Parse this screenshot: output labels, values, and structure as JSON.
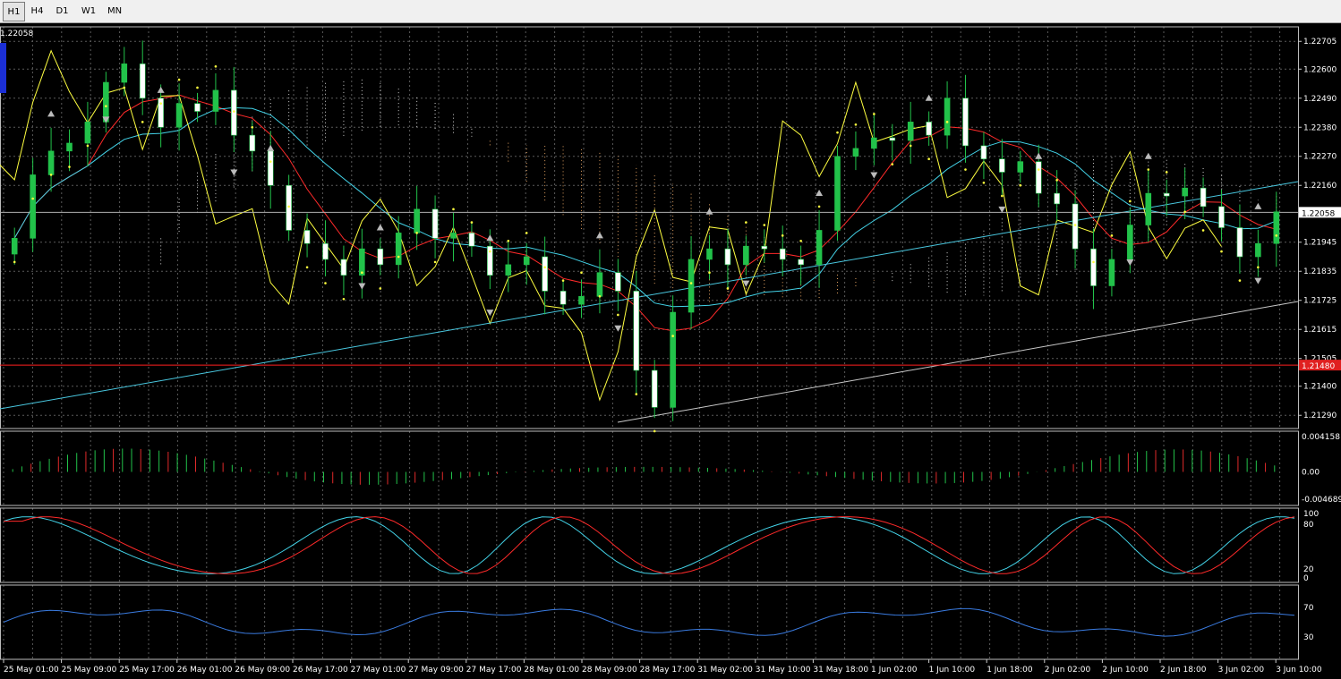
{
  "toolbar": {
    "timeframes": [
      {
        "label": "H1",
        "active": true
      },
      {
        "label": "H4",
        "active": false
      },
      {
        "label": "D1",
        "active": false
      },
      {
        "label": "W1",
        "active": false
      },
      {
        "label": "MN",
        "active": false
      }
    ]
  },
  "main_panel": {
    "top_left_price": "1.22058",
    "price_ticks": [
      "1.22705",
      "1.22600",
      "1.22490",
      "1.22380",
      "1.22270",
      "1.22160",
      "1.21945",
      "1.21835",
      "1.21725",
      "1.21615",
      "1.21505",
      "1.21400",
      "1.21290"
    ],
    "current_price": "1.22058",
    "red_level_label": "1.21480",
    "y_range": [
      1.2124,
      1.2276
    ]
  },
  "macd_panel": {
    "ticks": [
      "0.004158",
      "0.00",
      "-0.004689"
    ]
  },
  "stoch_panel": {
    "ticks": [
      "100",
      "80",
      "20",
      "0"
    ]
  },
  "rsi_panel": {
    "ticks": [
      "70",
      "30"
    ]
  },
  "time_axis": [
    "25 May 01:00",
    "25 May 09:00",
    "25 May 17:00",
    "26 May 01:00",
    "26 May 09:00",
    "26 May 17:00",
    "27 May 01:00",
    "27 May 09:00",
    "27 May 17:00",
    "28 May 01:00",
    "28 May 09:00",
    "28 May 17:00",
    "31 May 02:00",
    "31 May 10:00",
    "31 May 18:00",
    "1 Jun 02:00",
    "1 Jun 10:00",
    "1 Jun 18:00",
    "2 Jun 02:00",
    "2 Jun 10:00",
    "2 Jun 18:00",
    "3 Jun 02:00",
    "3 Jun 10:00"
  ],
  "colors": {
    "bull": "#22c24a",
    "bear": "#ffffff",
    "grid": "#5a5a5a",
    "kijun": "#ff2a2a",
    "tenkan": "#43d3e8",
    "chikou": "#ffff40",
    "trend_cyan": "#49c8e0",
    "trend_gray": "#c8c8c8",
    "level_red": "#ff2020",
    "macd_up": "#22c24a",
    "macd_down": "#e02a2a",
    "stoch_main": "#43d3e8",
    "stoch_signal": "#ff2a2a",
    "rsi": "#3a7be0"
  },
  "chart_data": {
    "type": "candlestick",
    "series_close": [
      1.2196,
      1.222,
      1.2229,
      1.2232,
      1.224,
      1.2255,
      1.2262,
      1.2249,
      1.2238,
      1.2247,
      1.2244,
      1.2252,
      1.2235,
      1.2229,
      1.2216,
      1.2199,
      1.2194,
      1.2188,
      1.2182,
      1.2192,
      1.2186,
      1.2198,
      1.2207,
      1.2196,
      1.2198,
      1.2193,
      1.2182,
      1.2186,
      1.2189,
      1.2176,
      1.2171,
      1.2174,
      1.2183,
      1.2176,
      1.2146,
      1.2132,
      1.2168,
      1.2188,
      1.2192,
      1.2186,
      1.2193,
      1.2192,
      1.2188,
      1.2186,
      1.2199,
      1.2227,
      1.223,
      1.2234,
      1.2233,
      1.224,
      1.2235,
      1.2249,
      1.2231,
      1.2226,
      1.2221,
      1.2225,
      1.2213,
      1.2209,
      1.2192,
      1.2178,
      1.2188,
      1.2201,
      1.2213,
      1.2212,
      1.2215,
      1.2208,
      1.22,
      1.2189,
      1.2194,
      1.2206
    ]
  }
}
